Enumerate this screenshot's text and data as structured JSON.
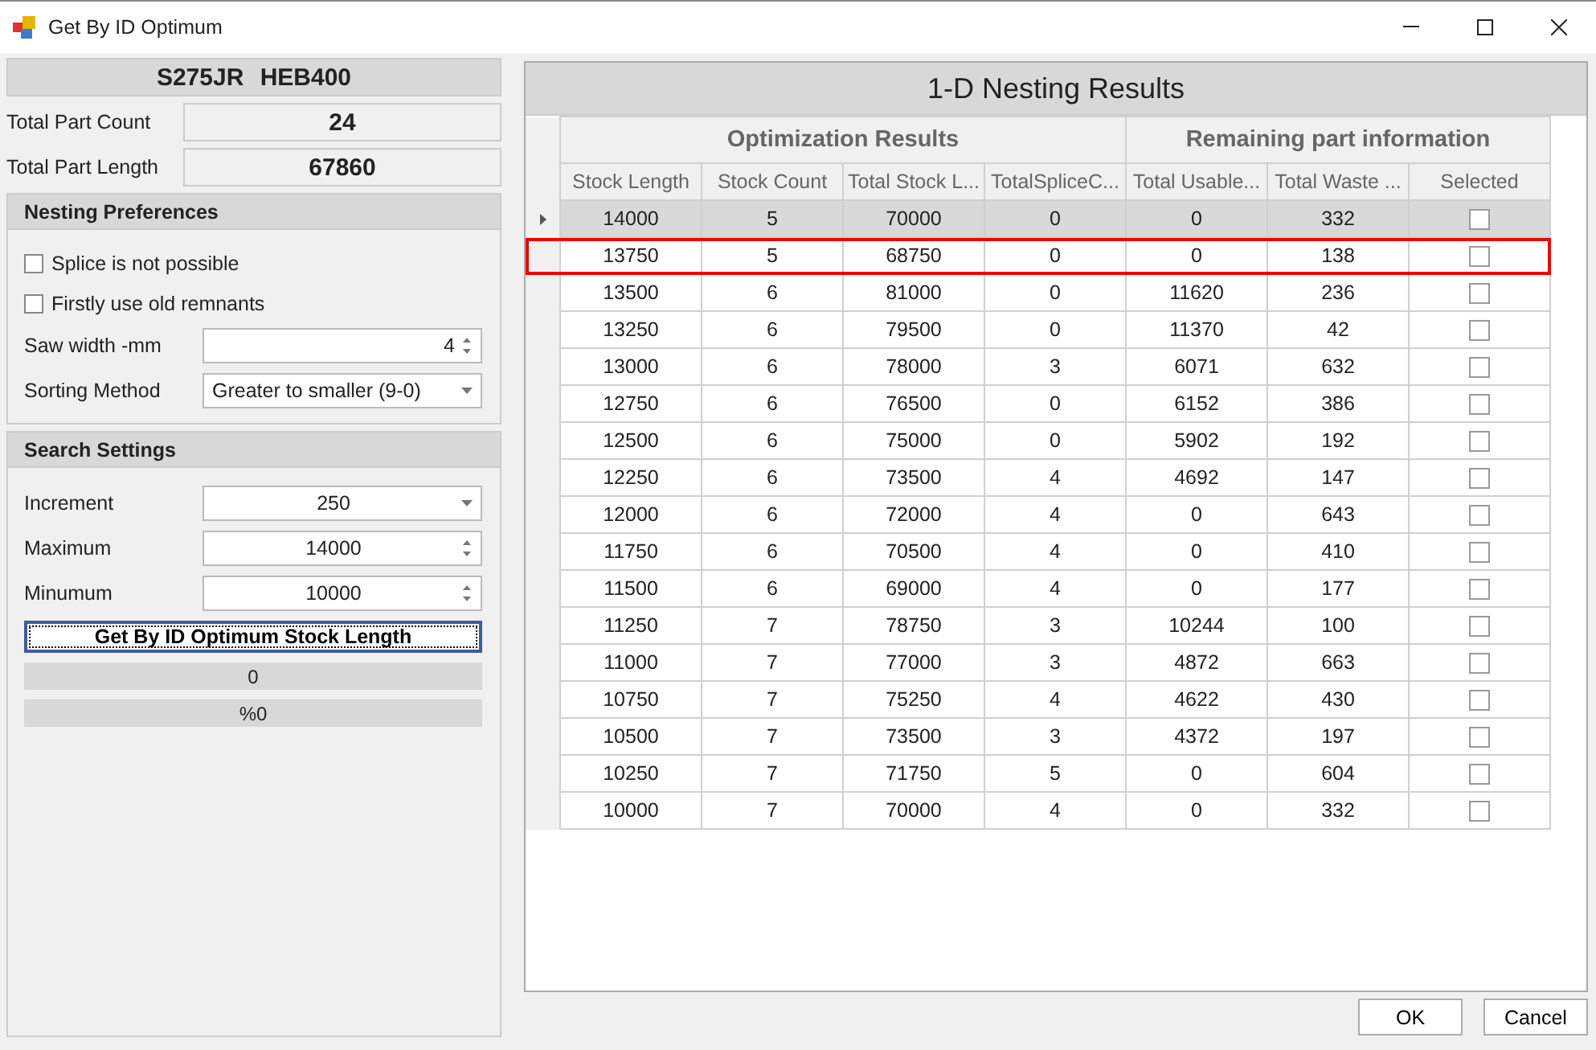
{
  "window": {
    "title": "Get By ID Optimum"
  },
  "profile": {
    "title": "S275JR HEB400",
    "fields": [
      {
        "label": "Total Part Count",
        "value": "24"
      },
      {
        "label": "Total Part Length",
        "value": "67860"
      }
    ]
  },
  "nesting_preferences": {
    "title": "Nesting Preferences",
    "options": [
      {
        "label": "Splice is not possible",
        "checked": false
      },
      {
        "label": "Firstly use old remnants",
        "checked": false
      }
    ],
    "fields": [
      {
        "label": "Saw width -mm",
        "value": "4",
        "kind": "spinner"
      },
      {
        "label": "Sorting Method",
        "value": "Greater to smaller (9-0)",
        "kind": "dropdown"
      }
    ]
  },
  "search_settings": {
    "title": "Search Settings",
    "fields": [
      {
        "label": "Increment",
        "value": "250",
        "kind": "dropdown"
      },
      {
        "label": "Maximum",
        "value": "14000",
        "kind": "spinner"
      },
      {
        "label": "Minumum",
        "value": "10000",
        "kind": "spinner"
      }
    ],
    "button": "Get By ID Optimum Stock Length",
    "counter": "0",
    "percent": "%0"
  },
  "results": {
    "title": "1-D Nesting Results",
    "groups": [
      {
        "label": "Optimization Results"
      },
      {
        "label": "Remaining part information"
      }
    ],
    "columns": [
      "Stock Length",
      "Stock Count",
      "Total Stock L...",
      "TotalSpliceC...",
      "Total Usable...",
      "Total Waste ...",
      "Selected"
    ],
    "rows": [
      {
        "cells": [
          "14000",
          "5",
          "70000",
          "0",
          "0",
          "332"
        ],
        "checked": false,
        "selected": true,
        "highlighted": false
      },
      {
        "cells": [
          "13750",
          "5",
          "68750",
          "0",
          "0",
          "138"
        ],
        "checked": false,
        "selected": false,
        "highlighted": true
      },
      {
        "cells": [
          "13500",
          "6",
          "81000",
          "0",
          "11620",
          "236"
        ],
        "checked": false,
        "selected": false,
        "highlighted": false
      },
      {
        "cells": [
          "13250",
          "6",
          "79500",
          "0",
          "11370",
          "42"
        ],
        "checked": false,
        "selected": false,
        "highlighted": false
      },
      {
        "cells": [
          "13000",
          "6",
          "78000",
          "3",
          "6071",
          "632"
        ],
        "checked": false,
        "selected": false,
        "highlighted": false
      },
      {
        "cells": [
          "12750",
          "6",
          "76500",
          "0",
          "6152",
          "386"
        ],
        "checked": false,
        "selected": false,
        "highlighted": false
      },
      {
        "cells": [
          "12500",
          "6",
          "75000",
          "0",
          "5902",
          "192"
        ],
        "checked": false,
        "selected": false,
        "highlighted": false
      },
      {
        "cells": [
          "12250",
          "6",
          "73500",
          "4",
          "4692",
          "147"
        ],
        "checked": false,
        "selected": false,
        "highlighted": false
      },
      {
        "cells": [
          "12000",
          "6",
          "72000",
          "4",
          "0",
          "643"
        ],
        "checked": false,
        "selected": false,
        "highlighted": false
      },
      {
        "cells": [
          "11750",
          "6",
          "70500",
          "4",
          "0",
          "410"
        ],
        "checked": false,
        "selected": false,
        "highlighted": false
      },
      {
        "cells": [
          "11500",
          "6",
          "69000",
          "4",
          "0",
          "177"
        ],
        "checked": false,
        "selected": false,
        "highlighted": false
      },
      {
        "cells": [
          "11250",
          "7",
          "78750",
          "3",
          "10244",
          "100"
        ],
        "checked": false,
        "selected": false,
        "highlighted": false
      },
      {
        "cells": [
          "11000",
          "7",
          "77000",
          "3",
          "4872",
          "663"
        ],
        "checked": false,
        "selected": false,
        "highlighted": false
      },
      {
        "cells": [
          "10750",
          "7",
          "75250",
          "4",
          "4622",
          "430"
        ],
        "checked": false,
        "selected": false,
        "highlighted": false
      },
      {
        "cells": [
          "10500",
          "7",
          "73500",
          "3",
          "4372",
          "197"
        ],
        "checked": false,
        "selected": false,
        "highlighted": false
      },
      {
        "cells": [
          "10250",
          "7",
          "71750",
          "5",
          "0",
          "604"
        ],
        "checked": false,
        "selected": false,
        "highlighted": false
      },
      {
        "cells": [
          "10000",
          "7",
          "70000",
          "4",
          "0",
          "332"
        ],
        "checked": false,
        "selected": false,
        "highlighted": false
      }
    ]
  },
  "buttons": [
    "OK",
    "Cancel"
  ]
}
